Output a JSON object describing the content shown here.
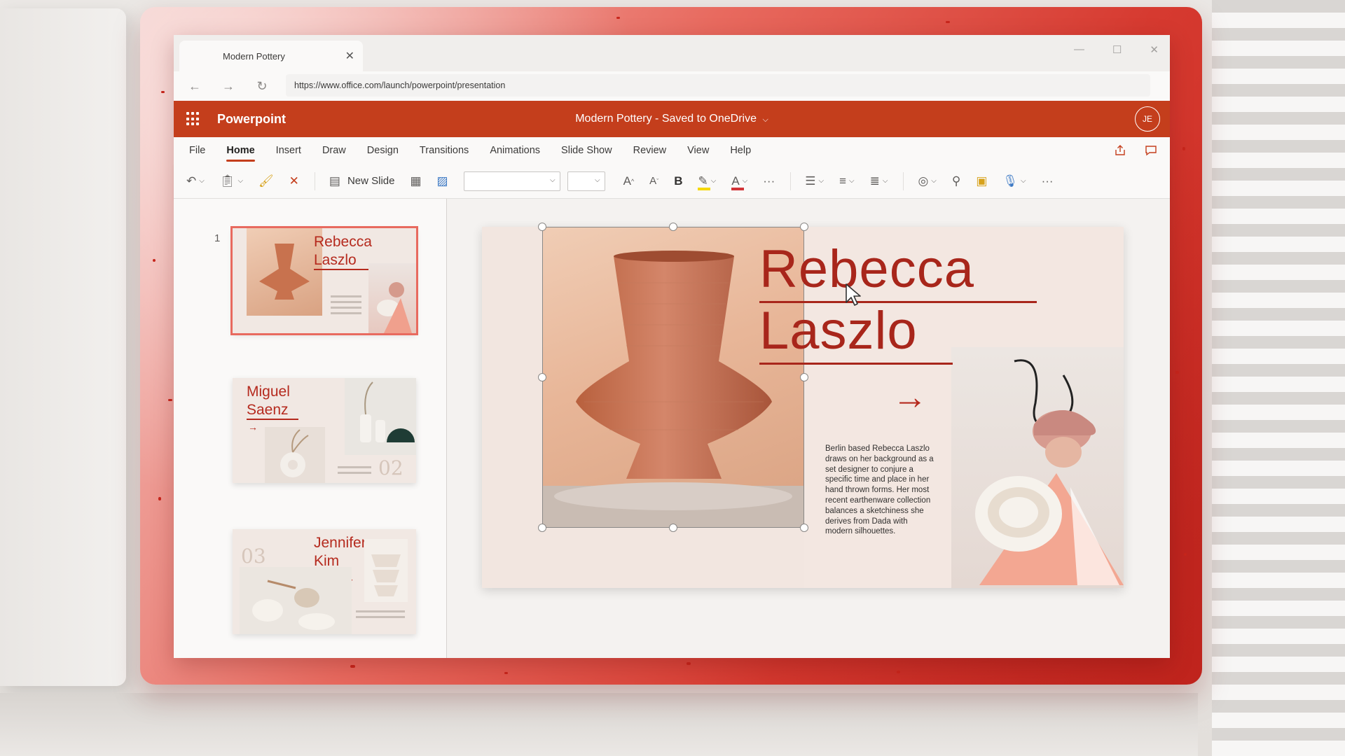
{
  "browser": {
    "tab_title": "Modern Pottery",
    "url": "https://www.office.com/launch/powerpoint/presentation"
  },
  "app": {
    "name": "Powerpoint",
    "doc_title": "Modern Pottery - Saved to OneDrive",
    "user_initials": "JE",
    "accent_color": "#c43e1c"
  },
  "menu": {
    "items": [
      "File",
      "Home",
      "Insert",
      "Draw",
      "Design",
      "Transitions",
      "Animations",
      "Slide Show",
      "Review",
      "View",
      "Help"
    ],
    "active": "Home"
  },
  "toolbar": {
    "new_slide_label": "New Slide",
    "icons": [
      "undo-icon",
      "paste-icon",
      "format-painter-icon",
      "clear-formatting-icon",
      "new-slide-icon",
      "layout-icon",
      "picture-icon",
      "font-family-select",
      "font-size-select",
      "grow-font-icon",
      "shrink-font-icon",
      "bold-icon",
      "highlight-icon",
      "font-color-icon",
      "more-icon",
      "bullets-icon",
      "numbering-icon",
      "align-icon",
      "shapes-icon",
      "find-icon",
      "designer-icon",
      "dictate-icon",
      "more-options-icon"
    ]
  },
  "thumbnails": {
    "selected_number": "1",
    "slides": [
      {
        "title_line1": "Rebecca",
        "title_line2": "Laszlo"
      },
      {
        "title_line1": "Miguel",
        "title_line2": "Saenz",
        "number": "02"
      },
      {
        "title_line1": "Jennifer",
        "title_line2": "Kim",
        "number": "03"
      }
    ]
  },
  "slide": {
    "title_line1": "Rebecca",
    "title_line2": "Laszlo",
    "body": "Berlin based Rebecca Laszlo draws on her background as a set designer to conjure a specific time and place in her hand thrown forms. Her most recent earthenware collection balances a sketchiness she derives from Dada with modern silhouettes.",
    "title_color": "#a8261b"
  }
}
